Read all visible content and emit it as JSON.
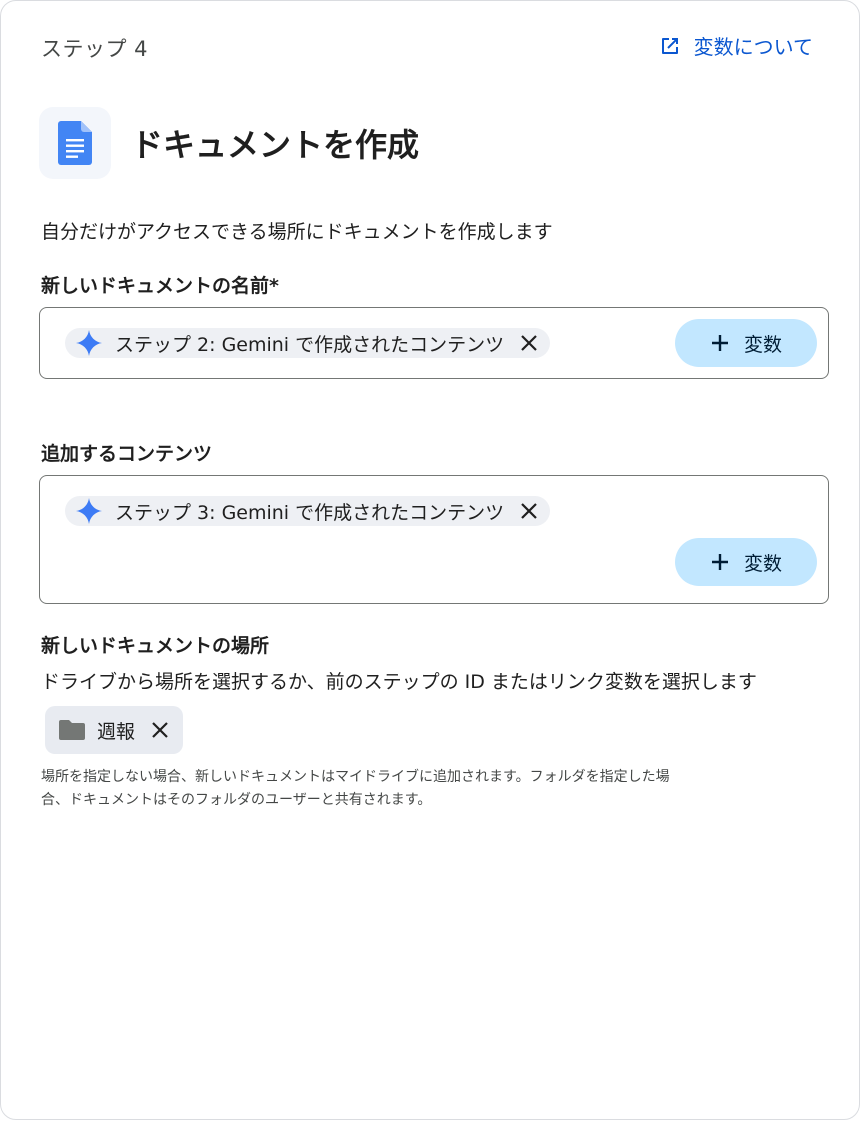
{
  "step": {
    "label": "ステップ 4"
  },
  "about_link": {
    "label": "変数について",
    "icon": "open-in-new-icon"
  },
  "header": {
    "title": "ドキュメントを作成",
    "icon": "google-docs-icon"
  },
  "description": "自分だけがアクセスできる場所にドキュメントを作成します",
  "name_field": {
    "label": "新しいドキュメントの名前*",
    "chip": {
      "label": "ステップ 2: Gemini で作成されたコンテンツ",
      "icon": "gemini-sparkle-icon"
    },
    "variable_button": "変数"
  },
  "content_field": {
    "label": "追加するコンテンツ",
    "chip": {
      "label": "ステップ 3: Gemini で作成されたコンテンツ",
      "icon": "gemini-sparkle-icon"
    },
    "variable_button": "変数"
  },
  "location": {
    "label": "新しいドキュメントの場所",
    "description": "ドライブから場所を選択するか、前のステップの ID またはリンク変数を選択します",
    "folder_chip": {
      "label": "週報",
      "icon": "folder-icon"
    },
    "hint_line1": "場所を指定しない場合、新しいドキュメントはマイドライブに追加されます。フォルダを指定した場",
    "hint_line2": "合、ドキュメントはそのフォルダのユーザーと共有されます。"
  },
  "colors": {
    "accent": "#0b57d0",
    "variable_button_bg": "#c2e7ff",
    "chip_bg": "#eef0f4",
    "docs_blue": "#4285f4"
  }
}
